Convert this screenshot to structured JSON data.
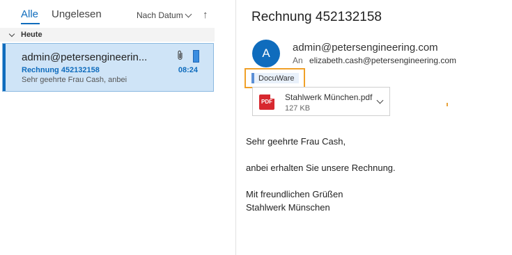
{
  "list": {
    "tabs": [
      {
        "label": "Alle",
        "active": true
      },
      {
        "label": "Ungelesen",
        "active": false
      }
    ],
    "sort_label": "Nach Datum",
    "sort_direction_icon": "up-arrow-icon",
    "group_header": "Heute",
    "mail": {
      "sender": "admin@petersengineerin...",
      "subject": "Rechnung 452132158",
      "preview": "Sehr geehrte Frau Cash,  anbei",
      "time": "08:24",
      "has_attachment": true
    }
  },
  "reading": {
    "subject": "Rechnung 452132158",
    "avatar_initial": "A",
    "from": "admin@petersengineering.com",
    "to_label": "An",
    "to": "elizabeth.cash@petersengineering.com",
    "category_tag": "DocuWare",
    "attachment": {
      "name": "Stahlwerk München.pdf",
      "size": "127 KB",
      "icon_label": "PDF"
    },
    "body": {
      "greeting": "Sehr geehrte Frau Cash,",
      "line1": "anbei erhalten Sie unsere Rechnung.",
      "closing": "Mit freundlichen Grüßen",
      "signature": "Stahlwerk Münschen"
    }
  },
  "colors": {
    "accent": "#0f6cbd",
    "selection": "#cfe4f7",
    "highlight_border": "#f0a028",
    "pdf": "#d7282f"
  }
}
